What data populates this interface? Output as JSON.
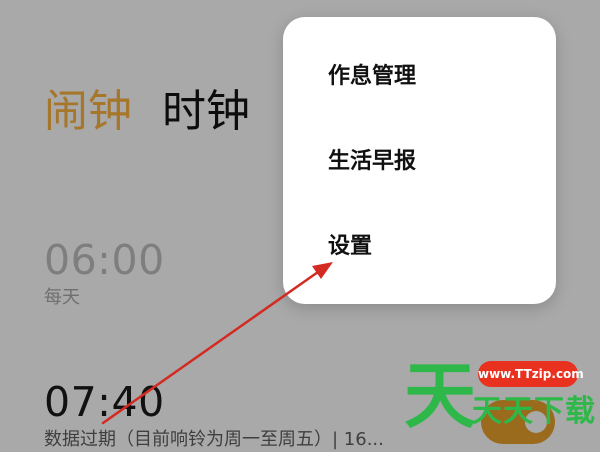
{
  "tabs": [
    {
      "label": "闹钟",
      "active": true
    },
    {
      "label": "时钟",
      "active": false
    }
  ],
  "alarms": [
    {
      "time": "06:00",
      "repeat": "每天",
      "enabled": false
    },
    {
      "time": "07:40",
      "repeat": "数据过期（目前响铃为周一至周五）| 16...",
      "enabled": true
    }
  ],
  "menu": {
    "items": [
      {
        "label": "作息管理"
      },
      {
        "label": "生活早报"
      },
      {
        "label": "设置"
      }
    ]
  },
  "watermark": {
    "logo_char": "天",
    "url": "www.TTzip.com",
    "text": "天天下载"
  },
  "colors": {
    "accent": "#a6762a",
    "background": "#a9a9a9",
    "annotation_arrow": "#d32a22",
    "watermark_green": "#2eb84a",
    "watermark_red": "#e8311f"
  }
}
